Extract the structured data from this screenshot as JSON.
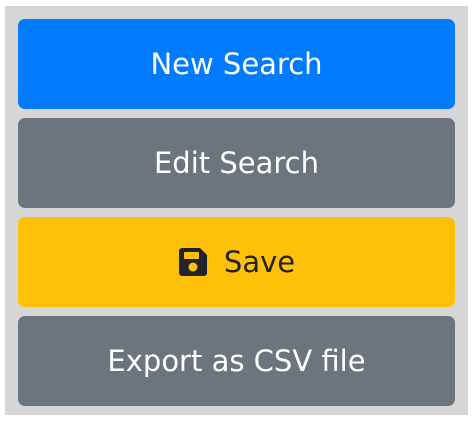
{
  "buttons": {
    "new_search": {
      "label": "New Search"
    },
    "edit_search": {
      "label": "Edit Search"
    },
    "save": {
      "label": "Save",
      "icon": "save-icon"
    },
    "export_csv": {
      "label": "Export as CSV file"
    }
  },
  "colors": {
    "panel_background": "#d6d6d6",
    "primary": "#007bff",
    "secondary": "#6c757d",
    "warning": "#ffc107",
    "warning_text": "#212529",
    "button_text": "#ffffff"
  }
}
